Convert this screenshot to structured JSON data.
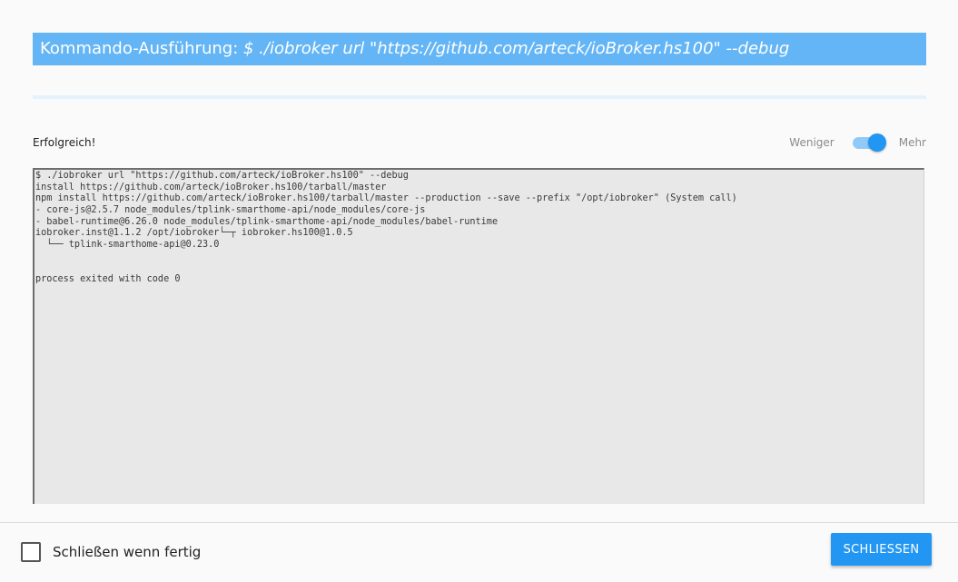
{
  "dialog": {
    "title_prefix": "Kommando-Ausführung: ",
    "title_command": "$ ./iobroker url \"https://github.com/arteck/ioBroker.hs100\" --debug",
    "progress_percent": 100,
    "status": "Erfolgreich!",
    "toggle": {
      "less_label": "Weniger",
      "more_label": "Mehr",
      "state": "on"
    },
    "log_lines": [
      "$ ./iobroker url \"https://github.com/arteck/ioBroker.hs100\" --debug",
      "install https://github.com/arteck/ioBroker.hs100/tarball/master",
      "npm install https://github.com/arteck/ioBroker.hs100/tarball/master --production --save --prefix \"/opt/iobroker\" (System call)",
      "- core-js@2.5.7 node_modules/tplink-smarthome-api/node_modules/core-js",
      "- babel-runtime@6.26.0 node_modules/tplink-smarthome-api/node_modules/babel-runtime",
      "iobroker.inst@1.1.2 /opt/iobroker└─┬ iobroker.hs100@1.0.5",
      "  └── tplink-smarthome-api@0.23.0",
      "",
      "",
      "process exited with code 0"
    ],
    "footer": {
      "checkbox_label": "Schließen wenn fertig",
      "checkbox_checked": false,
      "close_button_label": "SCHLIESSEN"
    }
  },
  "colors": {
    "title_bg": "#64b5f6",
    "accent": "#2196f3",
    "toggle_track": "#90caf9",
    "log_bg": "#e8e8e8",
    "dialog_bg": "#fafafa"
  }
}
